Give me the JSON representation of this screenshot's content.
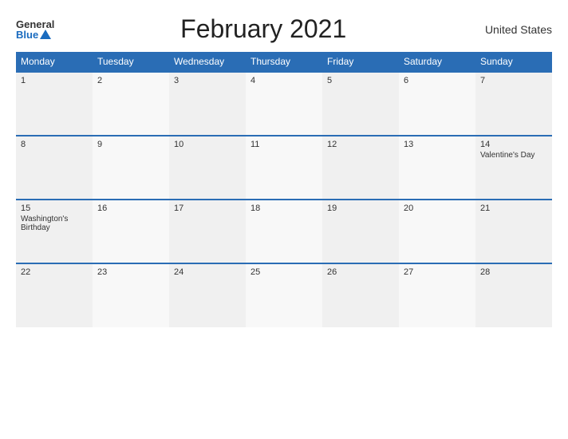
{
  "header": {
    "logo_general": "General",
    "logo_blue": "Blue",
    "title": "February 2021",
    "country": "United States"
  },
  "calendar": {
    "days_of_week": [
      "Monday",
      "Tuesday",
      "Wednesday",
      "Thursday",
      "Friday",
      "Saturday",
      "Sunday"
    ],
    "weeks": [
      [
        {
          "num": "1",
          "holiday": ""
        },
        {
          "num": "2",
          "holiday": ""
        },
        {
          "num": "3",
          "holiday": ""
        },
        {
          "num": "4",
          "holiday": ""
        },
        {
          "num": "5",
          "holiday": ""
        },
        {
          "num": "6",
          "holiday": ""
        },
        {
          "num": "7",
          "holiday": ""
        }
      ],
      [
        {
          "num": "8",
          "holiday": ""
        },
        {
          "num": "9",
          "holiday": ""
        },
        {
          "num": "10",
          "holiday": ""
        },
        {
          "num": "11",
          "holiday": ""
        },
        {
          "num": "12",
          "holiday": ""
        },
        {
          "num": "13",
          "holiday": ""
        },
        {
          "num": "14",
          "holiday": "Valentine's Day"
        }
      ],
      [
        {
          "num": "15",
          "holiday": "Washington's Birthday"
        },
        {
          "num": "16",
          "holiday": ""
        },
        {
          "num": "17",
          "holiday": ""
        },
        {
          "num": "18",
          "holiday": ""
        },
        {
          "num": "19",
          "holiday": ""
        },
        {
          "num": "20",
          "holiday": ""
        },
        {
          "num": "21",
          "holiday": ""
        }
      ],
      [
        {
          "num": "22",
          "holiday": ""
        },
        {
          "num": "23",
          "holiday": ""
        },
        {
          "num": "24",
          "holiday": ""
        },
        {
          "num": "25",
          "holiday": ""
        },
        {
          "num": "26",
          "holiday": ""
        },
        {
          "num": "27",
          "holiday": ""
        },
        {
          "num": "28",
          "holiday": ""
        }
      ]
    ]
  }
}
